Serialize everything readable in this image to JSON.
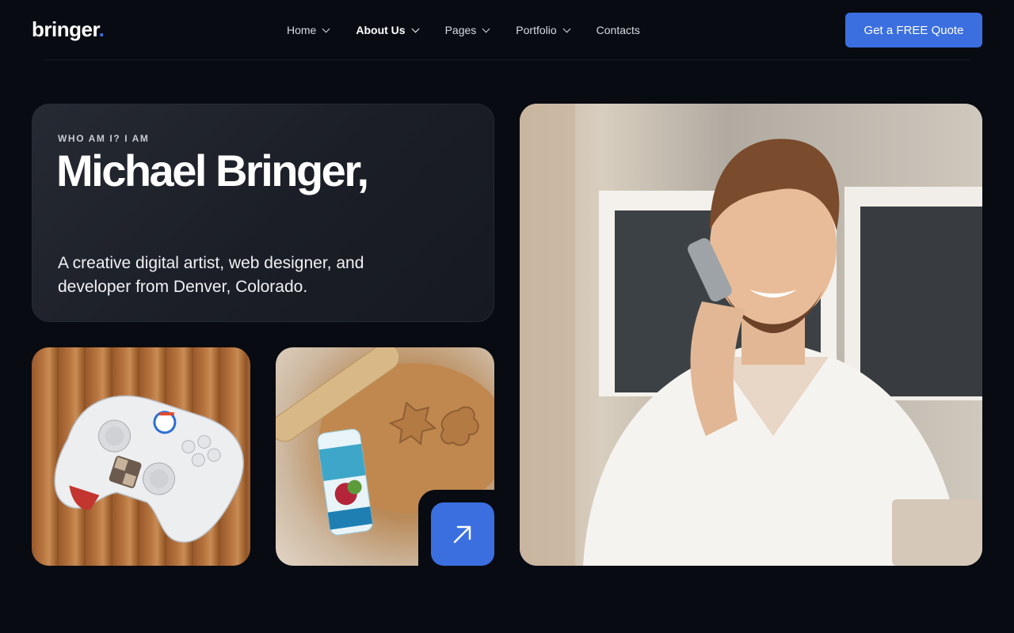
{
  "brand": {
    "name": "bringer",
    "dot": "."
  },
  "nav": {
    "items": [
      {
        "label": "Home",
        "has_dropdown": true,
        "active": false
      },
      {
        "label": "About Us",
        "has_dropdown": true,
        "active": true
      },
      {
        "label": "Pages",
        "has_dropdown": true,
        "active": false
      },
      {
        "label": "Portfolio",
        "has_dropdown": true,
        "active": false
      },
      {
        "label": "Contacts",
        "has_dropdown": false,
        "active": false
      }
    ],
    "cta_label": "Get a FREE Quote"
  },
  "hero": {
    "eyebrow": "WHO AM I? I AM",
    "name": "Michael Bringer,",
    "bio": "A creative digital artist, web designer, and developer from Denver, Colorado."
  },
  "images": {
    "controller": "game-controller-photo",
    "cookie": "cookie-dough-photo",
    "portrait": "man-on-phone-portrait"
  },
  "icons": {
    "arrow": "arrow-up-right-icon"
  },
  "colors": {
    "accent": "#3b6fe0",
    "background": "#080b12",
    "card": "#1f232b"
  }
}
